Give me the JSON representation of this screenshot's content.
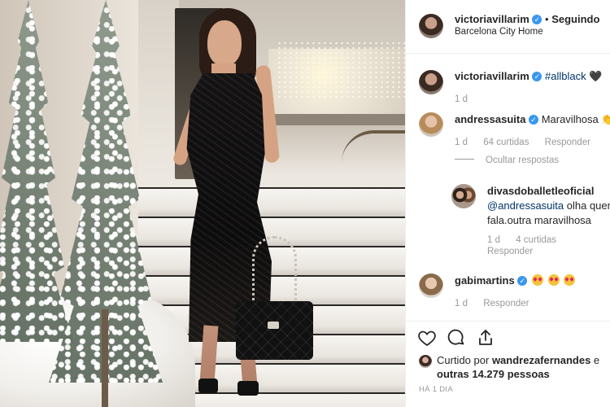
{
  "post": {
    "header": {
      "username": "victoriavillarim",
      "separator": "•",
      "follow_status": "Seguindo",
      "location": "Barcelona City Home"
    },
    "caption": {
      "username": "victoriavillarim",
      "hashtag": "#allblack",
      "emoji": "🖤",
      "time": "1 d"
    },
    "comments": [
      {
        "username": "andressasuita",
        "text": "Maravilhosa",
        "emoji": "👏",
        "time": "1 d",
        "likes": "64 curtidas",
        "reply_label": "Responder",
        "toggle_replies": "Ocultar respostas",
        "replies": [
          {
            "username": "divasdoballetleoficial",
            "mention": "@andressasuita",
            "text_line1": " olha quem",
            "text_line2": "fala.outra maravilhosa",
            "time": "1 d",
            "likes": "4 curtidas",
            "reply_label": "Responder"
          }
        ]
      },
      {
        "username": "gabimartins",
        "time": "1 d",
        "reply_label": "Responder"
      }
    ],
    "actions": {
      "like_icon": "heart-outline-icon",
      "comment_icon": "comment-bubble-icon",
      "share_icon": "share-arrow-icon"
    },
    "liked_by": {
      "prefix": "Curtido por",
      "username": "wandrezafernandes",
      "suffix": " e",
      "others": "outras 14.279 pessoas"
    },
    "timestamp": "HÁ 1 DIA"
  },
  "colors": {
    "verified": "#3897f0",
    "meta_gray": "#999999",
    "text": "#262626",
    "link": "#003569"
  }
}
